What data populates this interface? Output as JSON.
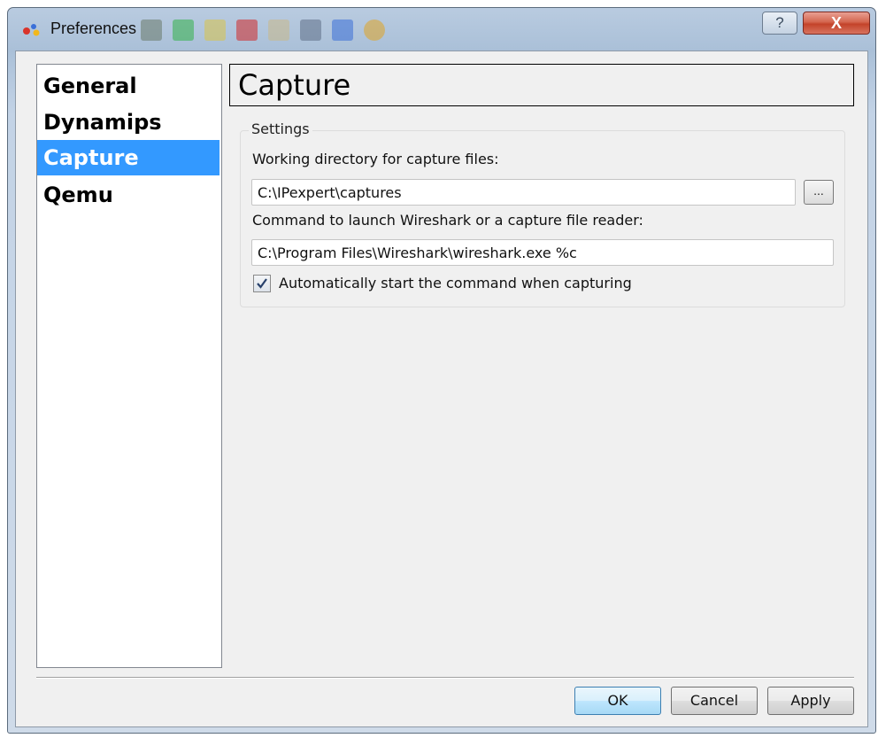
{
  "window": {
    "title": "Preferences",
    "help_glyph": "?",
    "close_glyph": "X"
  },
  "sidebar": {
    "items": [
      {
        "label": "General",
        "selected": false
      },
      {
        "label": "Dynamips",
        "selected": false
      },
      {
        "label": "Capture",
        "selected": true
      },
      {
        "label": "Qemu",
        "selected": false
      }
    ]
  },
  "page": {
    "title": "Capture"
  },
  "settings": {
    "group_title": "Settings",
    "working_dir_label": "Working directory for capture files:",
    "working_dir_value": "C:\\IPexpert\\captures",
    "browse_label": "...",
    "command_label": "Command to launch Wireshark or a capture file reader:",
    "command_value": "C:\\Program Files\\Wireshark\\wireshark.exe %c",
    "autostart_label": "Automatically start the command when capturing",
    "autostart_checked": true
  },
  "buttons": {
    "ok": "OK",
    "cancel": "Cancel",
    "apply": "Apply"
  },
  "colors": {
    "selection": "#3399ff",
    "close_button": "#c3432a"
  }
}
